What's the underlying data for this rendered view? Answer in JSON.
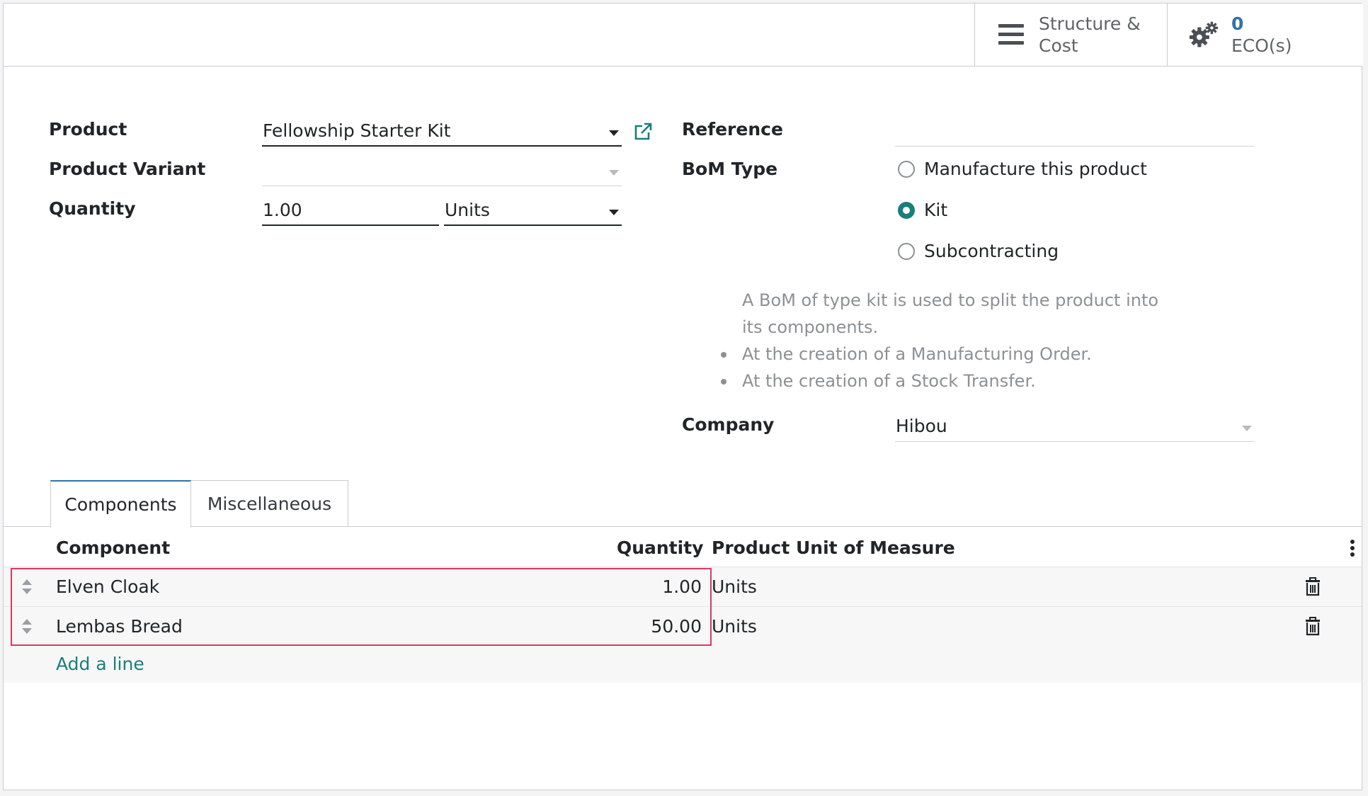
{
  "smart_buttons": {
    "structure": {
      "line1": "Structure &",
      "line2": "Cost"
    },
    "eco": {
      "count": "0",
      "label": "ECO(s)"
    }
  },
  "form": {
    "product": {
      "label": "Product",
      "value": "Fellowship Starter Kit"
    },
    "product_variant": {
      "label": "Product Variant",
      "value": ""
    },
    "quantity": {
      "label": "Quantity",
      "value": "1.00",
      "uom": "Units"
    },
    "reference": {
      "label": "Reference",
      "value": ""
    },
    "bom_type": {
      "label": "BoM Type",
      "options": [
        {
          "label": "Manufacture this product",
          "checked": false
        },
        {
          "label": "Kit",
          "checked": true
        },
        {
          "label": "Subcontracting",
          "checked": false
        }
      ],
      "help": {
        "intro": "A BoM of type kit is used to split the product into its components.",
        "bullets": [
          "At the creation of a Manufacturing Order.",
          "At the creation of a Stock Transfer."
        ]
      }
    },
    "company": {
      "label": "Company",
      "value": "Hibou"
    }
  },
  "tabs": [
    {
      "label": "Components",
      "active": true
    },
    {
      "label": "Miscellaneous",
      "active": false
    }
  ],
  "components_table": {
    "headers": [
      "Component",
      "Quantity",
      "Product Unit of Measure"
    ],
    "rows": [
      {
        "component": "Elven Cloak",
        "quantity": "1.00",
        "uom": "Units"
      },
      {
        "component": "Lembas Bread",
        "quantity": "50.00",
        "uom": "Units"
      }
    ],
    "add_line": "Add a line"
  },
  "colors": {
    "accent": "#1a7e79",
    "highlight": "#d63b63",
    "link_blue": "#2f72a8"
  }
}
